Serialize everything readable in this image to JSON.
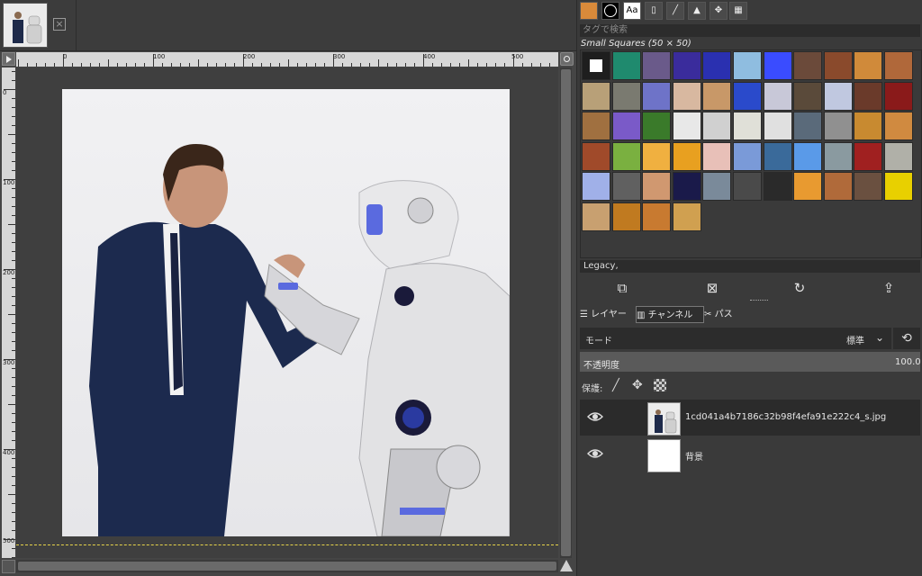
{
  "image_tab": {
    "thumbnail_icon": "image-thumbnail",
    "close_icon": "close-x-box"
  },
  "ruler": {
    "h_labels": [
      "0",
      "100",
      "200",
      "300",
      "400",
      "500"
    ],
    "v_labels": [
      "0",
      "100",
      "200",
      "300",
      "400",
      "500"
    ]
  },
  "patterns_dock": {
    "tag_search_placeholder": "タグで検索",
    "title": "Small Squares (50 × 50)",
    "tool_tabs": [
      "brushes-icon",
      "patterns-icon",
      "fonts-icon",
      "document-icon",
      "paintbrush-icon",
      "levels-icon",
      "transform-icon",
      "grid-icon"
    ],
    "patterns": [
      "#ffffff",
      "#1f8a6e",
      "#6a5a8a",
      "#3a2c9c",
      "#2a30b0",
      "#8fbde0",
      "#3a4cff",
      "#6b4a3a",
      "#8a4a2c",
      "#d08a3a",
      "#b0683a",
      "#b8a078",
      "#7a7a70",
      "#6e73c8",
      "#d8b8a0",
      "#c89868",
      "#2a4acb",
      "#c8c8d8",
      "#5a4a3a",
      "#c0c8e0",
      "#6a3a2a",
      "#8a1a1a",
      "#a07040",
      "#7a5ac8",
      "#3a7a2a",
      "#e8e8e8",
      "#d0d0d0",
      "#e0e0d8",
      "#e0e0e0",
      "#5a6a7a",
      "#909090",
      "#c88a30",
      "#d08a40",
      "#a04a2a",
      "#7ab040",
      "#f0b040",
      "#e8a020",
      "#e8c0b8",
      "#7a9ad8",
      "#3a6a9a",
      "#5a9ae8",
      "#8a9aa0",
      "#a02020",
      "#b0b0a8",
      "#a0b0e8",
      "#606060",
      "#d09870",
      "#1a1a4a",
      "#7a8a9a",
      "#4a4a4a",
      "#2a2a2a",
      "#e89a30",
      "#b06a3a",
      "#6a5040",
      "#e8d000",
      "#c8a070",
      "#c07a20",
      "#c87a30",
      "#d0a050"
    ]
  },
  "brush_preset": "Legacy,",
  "layers_dock": {
    "tabs": [
      {
        "label": "レイヤー",
        "icon": "layers-icon"
      },
      {
        "label": "チャンネル",
        "icon": "channels-icon"
      },
      {
        "label": "パス",
        "icon": "paths-icon"
      }
    ],
    "mode_label": "モード",
    "mode_value": "標準",
    "opacity_label": "不透明度",
    "opacity_value": "100.0",
    "lock_label": "保護:",
    "layers": [
      {
        "name": "1cd041a4b7186c32b98f4efa91e222c4_s.jpg",
        "visible": true,
        "selected": true
      },
      {
        "name": "背景",
        "visible": true,
        "selected": false
      }
    ]
  }
}
